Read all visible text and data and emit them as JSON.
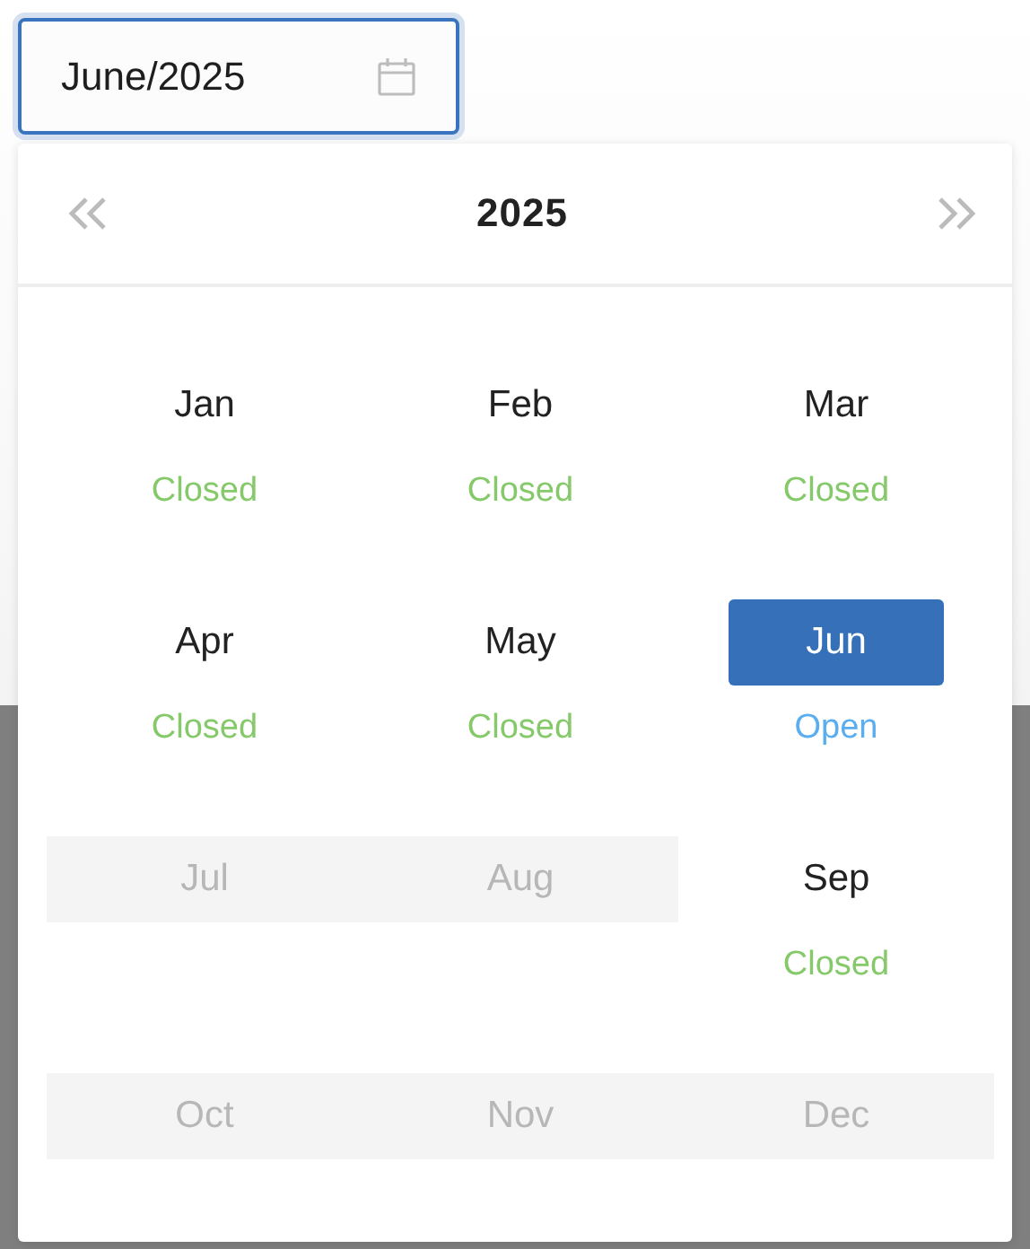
{
  "date_field": {
    "value": "June/2025"
  },
  "picker": {
    "year": "2025",
    "months": [
      {
        "label": "Jan",
        "status": "Closed",
        "color": "#86c96a",
        "disabled": false,
        "selected": false
      },
      {
        "label": "Feb",
        "status": "Closed",
        "color": "#86c96a",
        "disabled": false,
        "selected": false
      },
      {
        "label": "Mar",
        "status": "Closed",
        "color": "#86c96a",
        "disabled": false,
        "selected": false
      },
      {
        "label": "Apr",
        "status": "Closed",
        "color": "#86c96a",
        "disabled": false,
        "selected": false
      },
      {
        "label": "May",
        "status": "Closed",
        "color": "#86c96a",
        "disabled": false,
        "selected": false
      },
      {
        "label": "Jun",
        "status": "Open",
        "color": "#5aaef0",
        "disabled": false,
        "selected": true
      },
      {
        "label": "Jul",
        "disabled": true,
        "selected": false
      },
      {
        "label": "Aug",
        "disabled": true,
        "selected": false
      },
      {
        "label": "Sep",
        "status": "Closed",
        "color": "#86c96a",
        "disabled": false,
        "selected": false
      },
      {
        "label": "Oct",
        "disabled": true,
        "selected": false
      },
      {
        "label": "Nov",
        "disabled": true,
        "selected": false
      },
      {
        "label": "Dec",
        "disabled": true,
        "selected": false
      }
    ]
  }
}
